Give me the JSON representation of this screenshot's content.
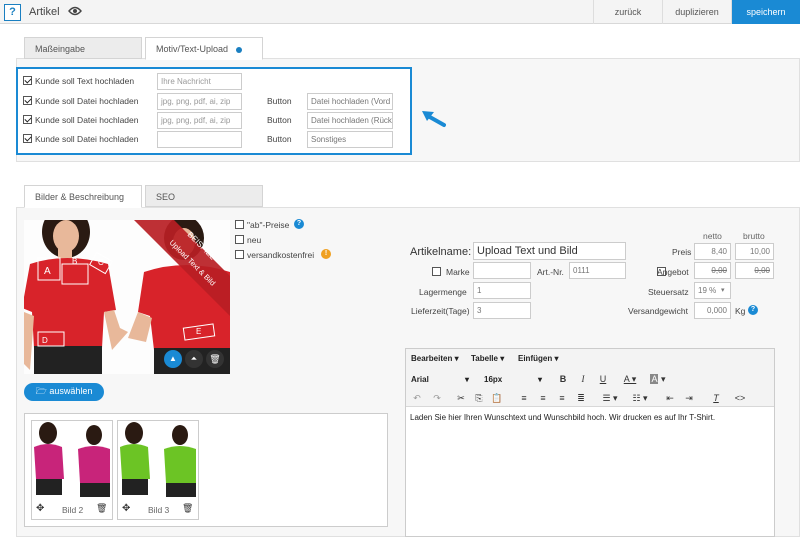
{
  "header": {
    "title": "Artikel",
    "buttons": {
      "back": "zurück",
      "duplicate": "duplizieren",
      "save": "speichern"
    },
    "help": "?"
  },
  "tabs_top": [
    {
      "label": "Maßeingabe"
    },
    {
      "label": "Motiv/Text-Upload"
    }
  ],
  "upload_rows": [
    {
      "label": "Kunde soll Text hochladen",
      "value": "Ihre Nachricht",
      "button_label": "",
      "button_value": ""
    },
    {
      "label": "Kunde soll Datei hochladen",
      "value": "jpg,  png,  pdf, ai, zip",
      "button_label": "Button",
      "button_value": "Datei hochladen (Vord"
    },
    {
      "label": "Kunde soll Datei hochladen",
      "value": "jpg,  png,  pdf, ai, zip",
      "button_label": "Button",
      "button_value": "Datei hochladen (Rück"
    },
    {
      "label": "Kunde soll Datei hochladen",
      "value": "",
      "button_label": "Button",
      "button_value": "Sonstiges"
    }
  ],
  "tabs_mid": [
    {
      "label": "Bilder & Beschreibung"
    },
    {
      "label": "SEO"
    }
  ],
  "image": {
    "banner": "BEISPIEL",
    "banner2": "Upload Text & Bild",
    "marks": [
      "A",
      "B",
      "C",
      "D",
      "E"
    ],
    "select_button": "auswählen"
  },
  "flags": [
    {
      "label": "\"ab\"-Preise",
      "icon": "help-icon"
    },
    {
      "label": "neu"
    },
    {
      "label": "versandkostenfrei",
      "icon": "warning-icon"
    }
  ],
  "thumbs": [
    {
      "label": "Bild 2",
      "color": "#c8247a"
    },
    {
      "label": "Bild 3",
      "color": "#6cc425"
    }
  ],
  "article": {
    "name_label": "Artikelname:",
    "name_value": "Upload Text und Bild",
    "col_netto": "netto",
    "col_brutto": "brutto",
    "price_label": "Preis",
    "price_netto": "8,40",
    "price_brutto": "10,00",
    "brand_label": "Marke",
    "artnr_label": "Art.-Nr.",
    "artnr_value": "0111",
    "offer_label": "Angebot",
    "offer_netto": "0,00",
    "offer_brutto": "0,00",
    "stock_label": "Lagermenge",
    "stock_value": "1",
    "tax_label": "Steuersatz",
    "tax_value": "19 %",
    "delivery_label": "Lieferzeit(Tage)",
    "delivery_value": "3",
    "weight_label": "Versandgewicht",
    "weight_value": "0,000",
    "weight_unit": "Kg"
  },
  "editor": {
    "menu": [
      "Bearbeiten",
      "Tabelle",
      "Einfügen"
    ],
    "font": "Arial",
    "size": "16px",
    "content": "Laden Sie hier Ihren Wunschtext und Wunschbild hoch. Wir drucken es auf Ihr T-Shirt."
  },
  "colors": {
    "accent": "#1a8ad4",
    "tshirt": "#d8232a"
  }
}
